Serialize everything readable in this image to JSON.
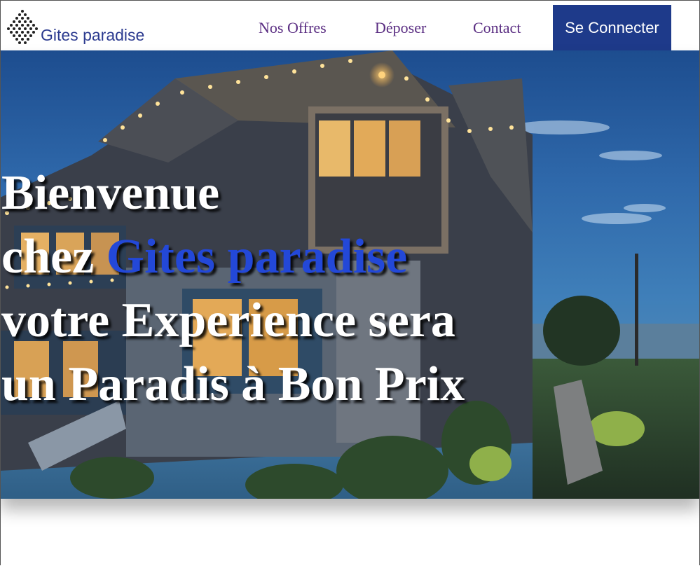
{
  "navbar": {
    "brand_name": "Gites paradise",
    "logo_icon": "diamond-dot-pattern-icon",
    "links": [
      "Nos Offres",
      "Déposer",
      "Contact"
    ],
    "login_label": "Se Connecter",
    "colors": {
      "brand": "#2b3a8f",
      "link": "#5a2d82",
      "button_bg": "#1e3a8a"
    }
  },
  "hero": {
    "line1": "Bienvenue",
    "line2_prefix": "chez ",
    "line2_brand": "Gites paradise",
    "line3": "votre Experience sera",
    "line4": "un Paradis à Bon Prix",
    "brand_color": "#2348d8"
  }
}
